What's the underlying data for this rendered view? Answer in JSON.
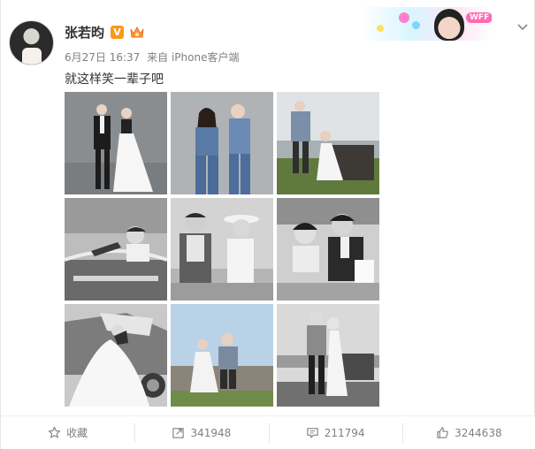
{
  "post": {
    "username": "张若昀",
    "vip_badge": "V",
    "vip_badge_icon": "verified-v-icon",
    "member_icon": "member-crown-icon",
    "banner_tag": "WFF",
    "time": "6月27日 16:37",
    "source": "来自 iPhone客户端",
    "text": "就这样笑一辈子吧",
    "menu_icon": "chevron-down-icon"
  },
  "photos": [
    {
      "name": "photo-1",
      "theme": "studio-couple-suit-gown"
    },
    {
      "name": "photo-2",
      "theme": "studio-couple-denim"
    },
    {
      "name": "photo-3",
      "theme": "seaside-couple-sitting"
    },
    {
      "name": "photo-4",
      "theme": "bw-couple-car-window"
    },
    {
      "name": "photo-5",
      "theme": "bw-couple-hats"
    },
    {
      "name": "photo-6",
      "theme": "bw-couple-cafe"
    },
    {
      "name": "photo-7",
      "theme": "bw-couple-car-gown"
    },
    {
      "name": "photo-8",
      "theme": "couple-sitting-rocks"
    },
    {
      "name": "photo-9",
      "theme": "couple-standing-coast"
    }
  ],
  "actions": {
    "favorite": {
      "label": "收藏",
      "icon": "star-icon"
    },
    "repost": {
      "label": "341948",
      "icon": "repost-icon"
    },
    "comment": {
      "label": "211794",
      "icon": "comment-icon"
    },
    "like": {
      "label": "3244638",
      "icon": "thumbs-up-icon"
    }
  },
  "colors": {
    "username": "#333333",
    "meta": "#808080",
    "vip_orange": "#f79a17",
    "footer_text": "#808080"
  }
}
